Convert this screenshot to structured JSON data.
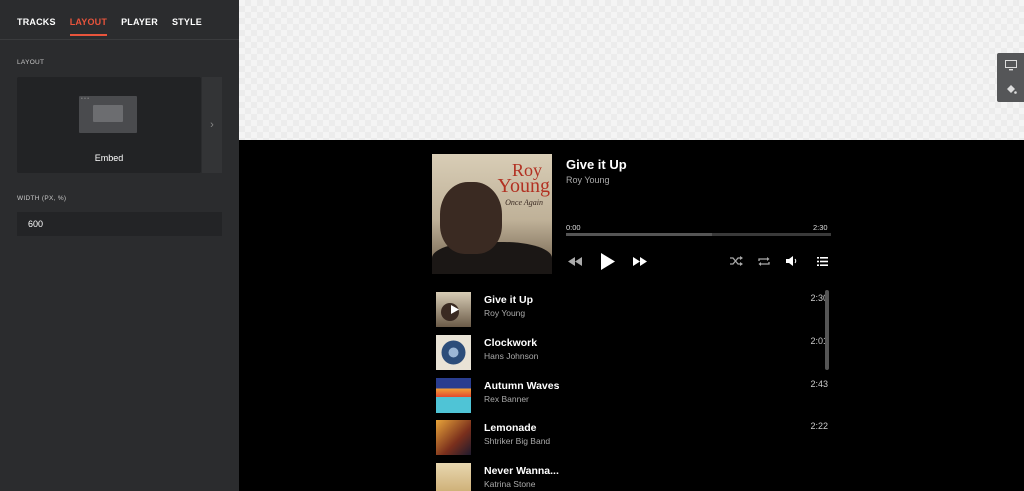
{
  "sidebar": {
    "tabs": [
      {
        "label": "TRACKS"
      },
      {
        "label": "LAYOUT"
      },
      {
        "label": "PLAYER"
      },
      {
        "label": "STYLE"
      }
    ],
    "active_tab": "LAYOUT",
    "layout_section_label": "LAYOUT",
    "layout_option_name": "Embed",
    "width_label": "WIDTH (PX, %)",
    "width_value": "600"
  },
  "colors": {
    "accent": "#e8543c",
    "sidebar_bg": "#2b2c2e",
    "player_bg": "#000000"
  },
  "side_tools": [
    {
      "icon": "monitor-icon"
    },
    {
      "icon": "paint-bucket-icon"
    }
  ],
  "player": {
    "cover": {
      "line1": "Roy",
      "line2": "Young",
      "line3": "Once Again"
    },
    "title": "Give it Up",
    "artist": "Roy Young",
    "current_time": "0:00",
    "duration": "2:30",
    "progress_fraction": 0.55
  },
  "tracks": [
    {
      "title": "Give it Up",
      "artist": "Roy Young",
      "duration": "2:30"
    },
    {
      "title": "Clockwork",
      "artist": "Hans Johnson",
      "duration": "2:01"
    },
    {
      "title": "Autumn Waves",
      "artist": "Rex Banner",
      "duration": "2:43"
    },
    {
      "title": "Lemonade",
      "artist": "Shtriker Big Band",
      "duration": "2:22"
    },
    {
      "title": "Never Wanna...",
      "artist": "Katrina Stone",
      "duration": ""
    }
  ]
}
